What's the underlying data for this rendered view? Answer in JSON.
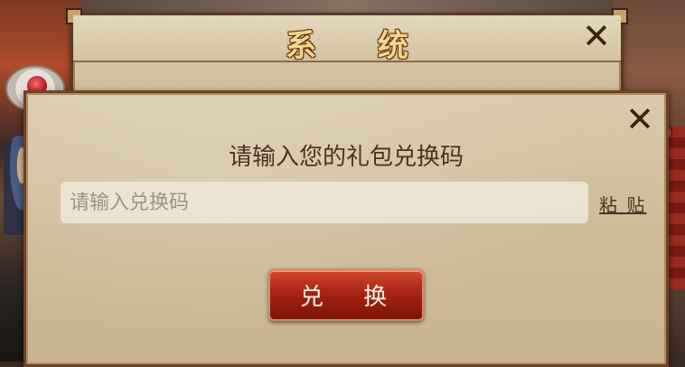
{
  "system_dialog": {
    "title": "系 统",
    "close_label": "✕"
  },
  "redeem_dialog": {
    "close_label": "✕",
    "prompt": "请输入您的礼包兑换码",
    "input": {
      "value": "",
      "placeholder": "请输入兑换码"
    },
    "paste_label": "粘 贴",
    "redeem_button_label": "兑 换"
  },
  "icons": {
    "close": "close-icon"
  },
  "colors": {
    "panel_bg": "#d4c4a4",
    "panel_border": "#6a4529",
    "title_gold": "#f4d58c",
    "button_red": "#a82412",
    "text_brown": "#4a3424"
  }
}
